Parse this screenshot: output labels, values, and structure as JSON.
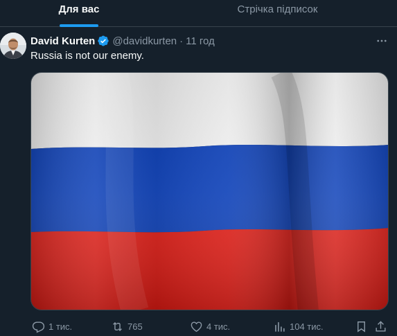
{
  "tabs": [
    {
      "label": "Для вас",
      "active": true
    },
    {
      "label": "Стрічка підписок",
      "active": false
    }
  ],
  "tweet": {
    "display_name": "David Kurten",
    "verified": true,
    "handle": "@davidkurten",
    "separator": "·",
    "time": "11 год",
    "text": "Russia is not our enemy.",
    "media_icon": "russian-flag-image",
    "actions": {
      "reply": "1 тис.",
      "retweet": "765",
      "like": "4 тис.",
      "views": "104 тис."
    }
  },
  "colors": {
    "background": "#15202b",
    "accent": "#1d9bf0",
    "muted": "#8b98a5",
    "flag_white": "#f2f2f2",
    "flag_blue": "#0b3fb8",
    "flag_red": "#e01a13"
  }
}
